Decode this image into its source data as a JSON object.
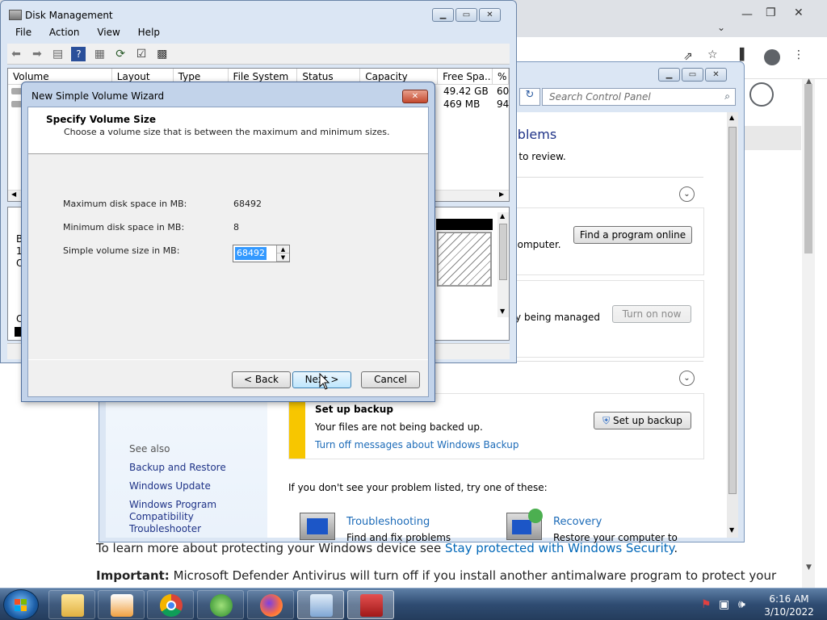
{
  "browser": {
    "body_text_1": "To learn more about protecting your Windows device see ",
    "body_link_1": "Stay protected with Windows Security",
    "body_text_1_end": ".",
    "important_label": "Important:",
    "important_text": " Microsoft Defender Antivirus will turn off if you install another antimalware program to protect your"
  },
  "control_panel": {
    "search_placeholder": "Search Control Panel",
    "heading_partial": "oblems",
    "subtext_partial": "n to review.",
    "find_program_text": "computer.",
    "find_program_button": "Find a program online",
    "managed_text": "tly being managed",
    "turn_on_button": "Turn on now",
    "backup_title": "Set up backup",
    "backup_desc": "Your files are not being backed up.",
    "backup_link": "Turn off messages about Windows Backup",
    "backup_button": "Set up backup",
    "not_listed": "If you don't see your problem listed, try one of these:",
    "troubleshoot_title": "Troubleshooting",
    "troubleshoot_desc": "Find and fix problems",
    "recovery_title": "Recovery",
    "recovery_desc": "Restore your computer to",
    "see_also": "See also",
    "see_also_links": [
      "Backup and Restore",
      "Windows Update",
      "Windows Program Compatibility Troubleshooter"
    ]
  },
  "disk_management": {
    "title": "Disk Management",
    "menu": [
      "File",
      "Action",
      "View",
      "Help"
    ],
    "columns": [
      "Volume",
      "Layout",
      "Type",
      "File System",
      "Status",
      "Capacity",
      "Free Spa...",
      "% F"
    ],
    "rows": [
      {
        "free": "49.42 GB",
        "pct": "60"
      },
      {
        "free": "469 MB",
        "pct": "94"
      }
    ],
    "graph_left_chars": [
      "B",
      "1",
      "O",
      "C"
    ]
  },
  "wizard": {
    "title": "New Simple Volume Wizard",
    "heading": "Specify Volume Size",
    "subheading": "Choose a volume size that is between the maximum and minimum sizes.",
    "max_label": "Maximum disk space in MB:",
    "max_value": "68492",
    "min_label": "Minimum disk space in MB:",
    "min_value": "8",
    "size_label": "Simple volume size in MB:",
    "size_value": "68492",
    "back_button": "< Back",
    "next_button": "Next >",
    "cancel_button": "Cancel"
  },
  "taskbar": {
    "time": "6:16 AM",
    "date": "3/10/2022",
    "apps": [
      "windows-explorer",
      "media-player",
      "chrome",
      "windows-security",
      "firefox",
      "control-panel",
      "toolbox"
    ]
  }
}
